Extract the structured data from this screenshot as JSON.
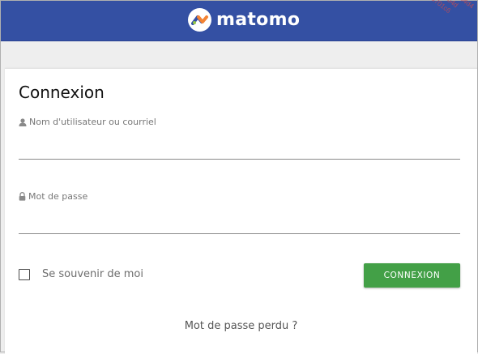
{
  "header": {
    "logo_text": "matomo",
    "bg_color": "#3450a3",
    "watermark_lines": [
      "b2b4a0a7-b49c-4b22-b4d4",
      "3dd3c73e20c94c1-b4d",
      "4016-46-03-b4d701c6",
      "bd701c6"
    ]
  },
  "login": {
    "title": "Connexion",
    "username_label": "Nom d'utilisateur ou courriel",
    "username_icon": "user-icon",
    "password_label": "Mot de passe",
    "password_icon": "lock-icon",
    "username_value": "",
    "password_value": "",
    "remember_label": "Se souvenir de moi",
    "remember_checked": false,
    "submit_label": "CONNEXION",
    "submit_color": "#43a047",
    "lost_password": "Mot de passe perdu ?"
  }
}
